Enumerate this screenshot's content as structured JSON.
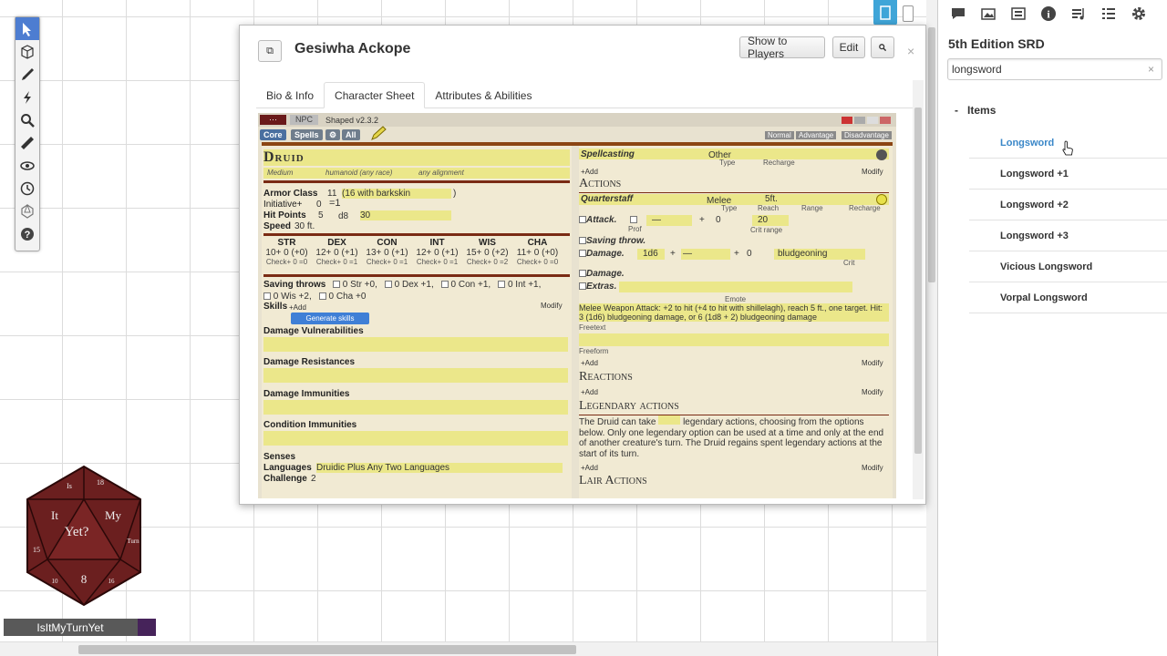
{
  "toolbar": {
    "tools": [
      "select-icon",
      "layers-icon",
      "draw-icon",
      "lightning-icon",
      "zoom-icon",
      "ruler-icon",
      "fog-eye-icon",
      "turn-tracker-icon",
      "dice-icon",
      "help-icon"
    ]
  },
  "dice_badge": {
    "label": "IsItMyTurnYet",
    "words": [
      "Is",
      "It",
      "My",
      "Yet?",
      "Turn",
      "8",
      "18",
      "15",
      "10",
      "16"
    ]
  },
  "dialog": {
    "title": "Gesiwha Ackope",
    "show_players": "Show to Players",
    "edit": "Edit",
    "search_icon": "search-icon",
    "close": "×",
    "tabs": [
      "Bio & Info",
      "Character Sheet",
      "Attributes & Abilities"
    ],
    "active_tab": "Character Sheet"
  },
  "sheet": {
    "npc": "NPC",
    "version": "Shaped v2.3.2",
    "pills": [
      "Core",
      "Spells",
      "⚙",
      "All"
    ],
    "modes": [
      "Normal",
      "Advantage",
      "Disadvantage"
    ],
    "name": "Druid",
    "size": "Medium",
    "type": "humanoid (any race)",
    "alignment": "any alignment",
    "ac_label": "Armor Class",
    "ac_value": "11",
    "ac_note": "(16 with barkskin",
    "ac_close": ")",
    "init_label": "Initiative+",
    "init_value": "0",
    "init_total": "=1",
    "hp_label": "Hit Points",
    "hp_value": "5",
    "hp_die": "d8",
    "hp_max": "30",
    "speed_label": "Speed",
    "speed_value": "30 ft.",
    "abilities": [
      {
        "name": "STR",
        "line": "10+ 0 (+0)",
        "check": "Check+ 0 =0"
      },
      {
        "name": "DEX",
        "line": "12+ 0 (+1)",
        "check": "Check+ 0 =1"
      },
      {
        "name": "CON",
        "line": "13+ 0 (+1)",
        "check": "Check+ 0 =1"
      },
      {
        "name": "INT",
        "line": "12+ 0 (+1)",
        "check": "Check+ 0 =1"
      },
      {
        "name": "WIS",
        "line": "15+ 0 (+2)",
        "check": "Check+ 0 =2"
      },
      {
        "name": "CHA",
        "line": "11+ 0 (+0)",
        "check": "Check+ 0 =0"
      }
    ],
    "saving_label": "Saving throws",
    "saves_row1": [
      "0 Str +0,",
      "0 Dex +1,",
      "0 Con +1,",
      "0 Int +1,"
    ],
    "saves_row2": [
      "0 Wis +2,",
      "0 Cha +0"
    ],
    "skills_label": "Skills",
    "add": "+Add",
    "modify": "Modify",
    "generate_skills": "Generate skills",
    "dmg_vuln": "Damage Vulnerabilities",
    "dmg_res": "Damage Resistances",
    "dmg_imm": "Damage Immunities",
    "cond_imm": "Condition Immunities",
    "senses": "Senses",
    "languages_label": "Languages",
    "languages_value": "Druidic Plus Any Two Languages",
    "challenge_label": "Challenge",
    "challenge_value": "2",
    "spellcasting": "Spellcasting",
    "other": "Other",
    "type_lbl": "Type",
    "recharge_lbl": "Recharge",
    "actions": "Actions",
    "quarterstaff": "Quarterstaff",
    "melee": "Melee",
    "five_ft": "5ft.",
    "reach_lbl": "Reach",
    "range_lbl": "Range",
    "attack_lbl": "Attack.",
    "prof": "Prof",
    "dash": "—",
    "plus": "+",
    "zero": "0",
    "twenty": "20",
    "crit_range": "Crit range",
    "saving_throw": "Saving throw.",
    "damage_lbl": "Damage.",
    "die": "1d6",
    "bludgeoning": "bludgeoning",
    "crit": "Crit",
    "extras": "Extras.",
    "emote": "Emote",
    "melee_text": "Melee Weapon Attack: +2 to hit (+4 to hit with shillelagh), reach 5 ft., one target. Hit: 3 (1d6) bludgeoning damage, or 6 (1d8 + 2) bludgeoning damage",
    "freetext": "Freetext",
    "freeform": "Freeform",
    "reactions": "Reactions",
    "legendary": "Legendary actions",
    "legendary_text_a": "The Druid can take",
    "legendary_text_b": "legendary actions, choosing from the options below. Only one legendary option can be used at a time and only at the end of another creature's turn. The Druid regains spent legendary actions at the start of its turn.",
    "lair": "Lair Actions"
  },
  "rightpanel": {
    "icons": [
      "chat-icon",
      "art-icon",
      "journal-icon",
      "info-icon",
      "jukebox-icon",
      "list-icon",
      "gear-icon"
    ],
    "title": "5th Edition SRD",
    "search_value": "longsword",
    "clear": "×",
    "items_header": "Items",
    "items_toggle": "-",
    "items": [
      "Longsword",
      "Longsword +1",
      "Longsword +2",
      "Longsword +3",
      "Vicious Longsword",
      "Vorpal Longsword"
    ]
  }
}
